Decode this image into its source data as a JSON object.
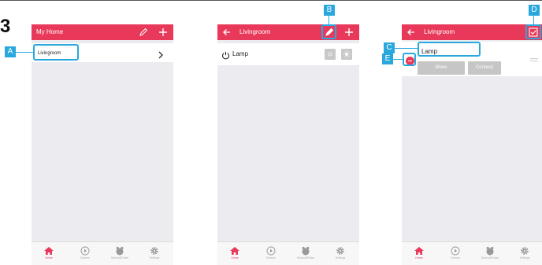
{
  "step_number": "3",
  "colors": {
    "accent": "#e8395a",
    "callout": "#2aa8de",
    "background": "#ebebf0"
  },
  "tabbar": {
    "tabs": [
      {
        "label": "Home",
        "icon": "home-icon",
        "active": true
      },
      {
        "label": "Scenes",
        "icon": "play-circle-icon",
        "active": false
      },
      {
        "label": "Sensor&Rules",
        "icon": "rules-icon",
        "active": false
      },
      {
        "label": "Settings",
        "icon": "gear-icon",
        "active": false
      }
    ]
  },
  "screen1": {
    "title": "My Home",
    "header_icons": [
      "pencil-icon",
      "plus-icon"
    ],
    "rooms": [
      {
        "label": "Livingroom",
        "icon": "chevron-right-icon"
      }
    ],
    "callouts": {
      "a": "A"
    }
  },
  "screen2": {
    "title": "Livingroom",
    "header_icons": [
      "back-arrow-icon",
      "pencil-icon",
      "plus-icon"
    ],
    "device": {
      "label": "Lamp",
      "icon": "power-icon",
      "controls": [
        "light-off-icon",
        "light-on-icon"
      ]
    },
    "callouts": {
      "b": "B"
    }
  },
  "screen3": {
    "title": "Livingroom",
    "header_icons": [
      "back-arrow-icon",
      "done-checkbox-icon"
    ],
    "device": {
      "name_value": "Lamp"
    },
    "buttons": {
      "move": "Move",
      "connect": "Connect"
    },
    "callouts": {
      "c": "C",
      "d": "D",
      "e": "E"
    }
  }
}
